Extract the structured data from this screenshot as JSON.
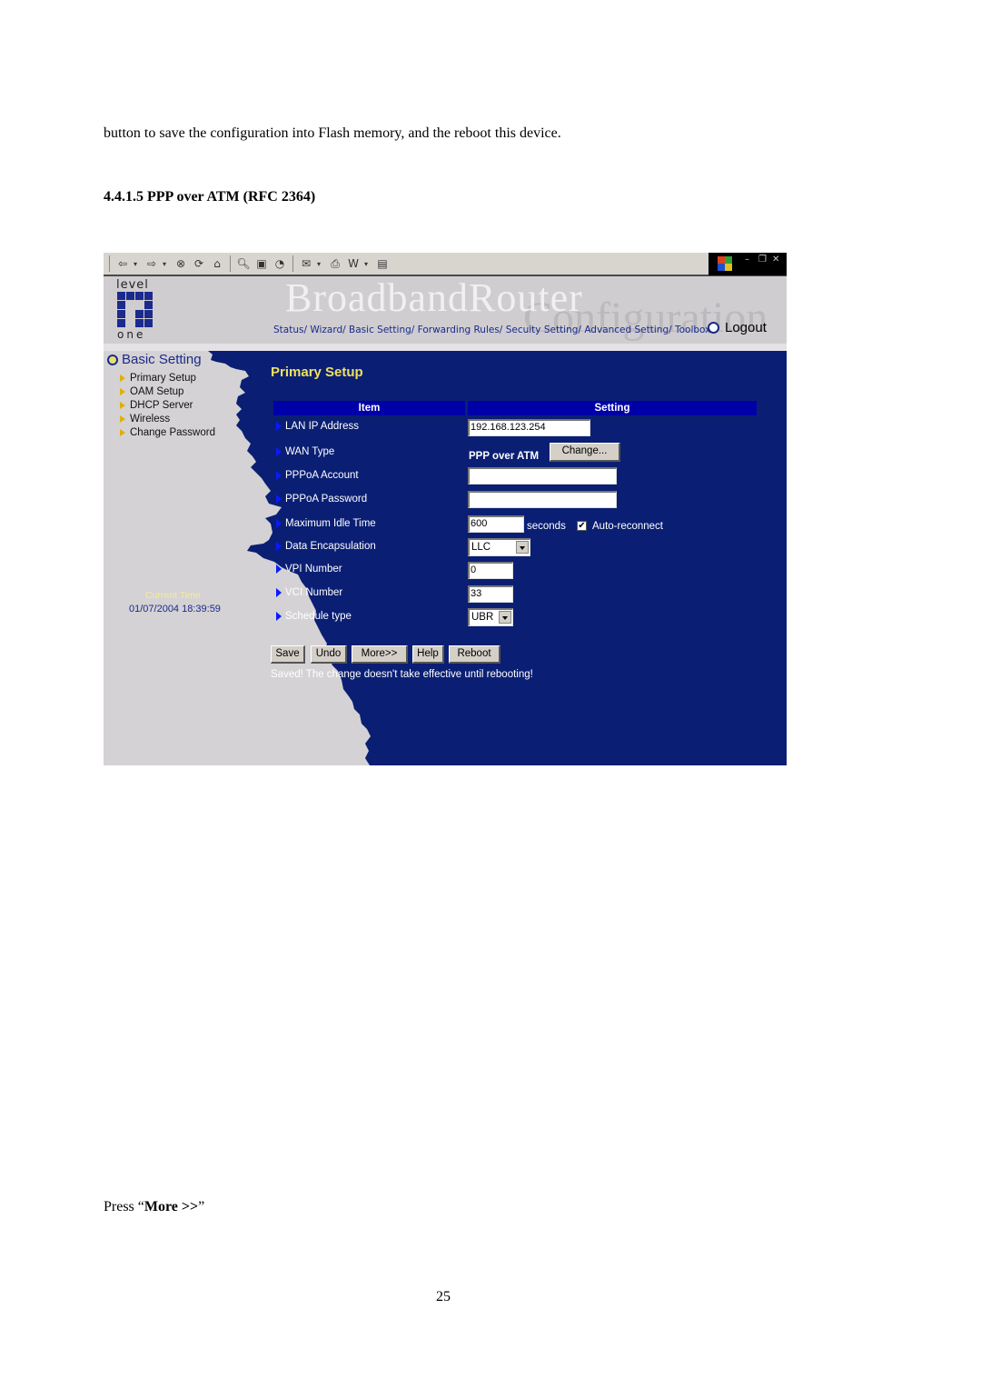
{
  "document": {
    "intro_text": "button to save the configuration into Flash memory, and the reboot this device.",
    "section_heading": "4.4.1.5 PPP over ATM (RFC 2364)",
    "press_prefix": "Press “",
    "press_bold": "More >>",
    "press_suffix": "”",
    "page_number": "25"
  },
  "browser_toolbar": {
    "icons": [
      "back-icon",
      "forward-icon",
      "stop-icon",
      "refresh-icon",
      "home-icon",
      "search-icon",
      "favorites-icon",
      "history-icon",
      "mail-icon",
      "print-icon",
      "word-icon",
      "notepad-icon"
    ],
    "window_controls": [
      "minimize",
      "restore",
      "close"
    ]
  },
  "banner": {
    "logo_top": "level",
    "logo_bottom": "one",
    "title": "BroadbandRouter",
    "subtitle": "Configuration",
    "nav_links": [
      "Status/",
      "Wizard/",
      "Basic Setting/",
      "Forwarding Rules/",
      "Secuity Setting/",
      "Advanced Setting/",
      "Toolbox"
    ],
    "logout_label": "Logout"
  },
  "sidebar": {
    "title": "Basic Setting",
    "items": [
      {
        "label": "Primary Setup"
      },
      {
        "label": "OAM Setup"
      },
      {
        "label": "DHCP Server"
      },
      {
        "label": "Wireless"
      },
      {
        "label": "Change Password"
      }
    ],
    "current_time_label": "Current Time",
    "current_time_value": "01/07/2004 18:39:59"
  },
  "main": {
    "title": "Primary Setup",
    "columns": {
      "item": "Item",
      "setting": "Setting"
    },
    "rows": {
      "lan_ip": {
        "label": "LAN IP Address",
        "value": "192.168.123.254"
      },
      "wan_type": {
        "label": "WAN Type",
        "value": "PPP over ATM",
        "button": "Change..."
      },
      "pppoa_account": {
        "label": "PPPoA Account",
        "value": ""
      },
      "pppoa_password": {
        "label": "PPPoA Password",
        "value": ""
      },
      "max_idle": {
        "label": "Maximum Idle Time",
        "value": "600",
        "unit": "seconds",
        "auto_reconnect_label": "Auto-reconnect",
        "auto_reconnect_checked": true,
        "check_glyph": "✔"
      },
      "data_encap": {
        "label": "Data Encapsulation",
        "value": "LLC"
      },
      "vpi": {
        "label": "VPI Number",
        "value": "0"
      },
      "vci": {
        "label": "VCI Number",
        "value": "33"
      },
      "schedule": {
        "label": "Schedule type",
        "value": "UBR"
      }
    },
    "buttons": {
      "save": "Save",
      "undo": "Undo",
      "more": "More>>",
      "help": "Help",
      "reboot": "Reboot"
    },
    "status_message": "Saved! The change doesn't take effective until rebooting!"
  },
  "colors": {
    "panel_blue": "#0a1f73",
    "header_blue": "#0000a8",
    "title_yellow": "#f0e060",
    "sidebar_gray": "#d4d2d4",
    "link_blue": "#1a2a8a"
  }
}
